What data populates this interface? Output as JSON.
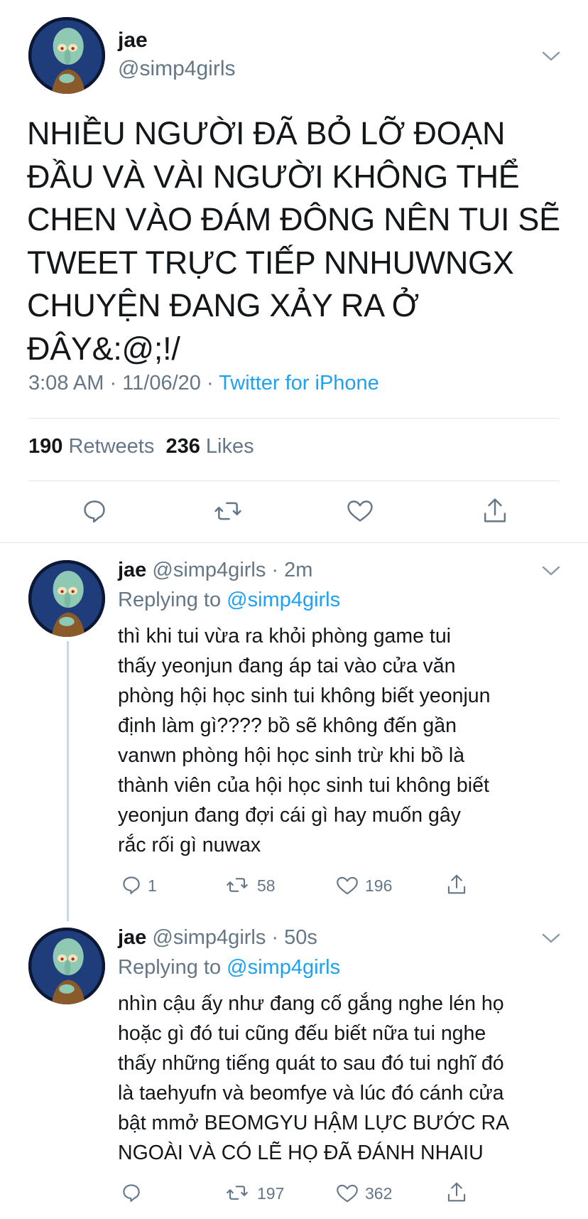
{
  "tweet": {
    "name": "jae",
    "handle": "@simp4girls",
    "text": "NHIỀU NGƯỜI ĐÃ BỎ LỠ ĐOẠN\nĐẦU VÀ VÀI NGƯỜI KHÔNG THỂ\nCHEN VÀO ĐÁM ĐÔNG NÊN TUI SẼ\nTWEET TRỰC TIẾP NNHUWNGX\nCHUYỆN ĐANG XẢY RA Ở ĐÂY&:@;!/",
    "time": "3:08 AM · 11/06/20 · ",
    "source": "Twitter for iPhone",
    "retweets_count": "190",
    "retweets_label": " Retweets",
    "likes_count": "236",
    "likes_label": " Likes"
  },
  "replies": [
    {
      "name": "jae",
      "handle": "@simp4girls",
      "age": "2m",
      "replying_label": "Replying to ",
      "replying_to": "@simp4girls",
      "text": "thì khi tui vừa ra khỏi phòng game tui\nthấy yeonjun đang áp tai vào cửa văn\nphòng hội học sinh tui không biết yeonjun\nđịnh làm gì???? bồ sẽ không đến gần\nvanwn phòng hội học sinh trừ khi bồ là\nthành viên của hội học sinh tui không biết\nyeonjun đang đợi cái gì hay muốn gây\nrắc rối gì nuwax",
      "reply_count": "1",
      "retweet_count": "58",
      "like_count": "196"
    },
    {
      "name": "jae",
      "handle": "@simp4girls",
      "age": "50s",
      "replying_label": "Replying to ",
      "replying_to": "@simp4girls",
      "text": "nhìn cậu ấy như đang cố gắng nghe lén họ\nhoặc gì đó tui cũng đếu biết nữa tui nghe\nthấy những tiếng quát to sau đó tui nghĩ đó\nlà taehyufn và beomfye và lúc đó cánh cửa\nbật mmở BEOMGYU HẬM LỰC BƯỚC RA\nNGOÀI VÀ CÓ LẼ HỌ ĐÃ ĐÁNH NHAIU",
      "reply_count": "",
      "retweet_count": "197",
      "like_count": "362"
    }
  ],
  "colors": {
    "link": "#1da1f2",
    "muted": "#657786",
    "text": "#14171a",
    "divider": "#e1e8ed"
  },
  "icons": [
    "chevron-down-icon",
    "reply-icon",
    "retweet-icon",
    "like-icon",
    "share-icon"
  ]
}
